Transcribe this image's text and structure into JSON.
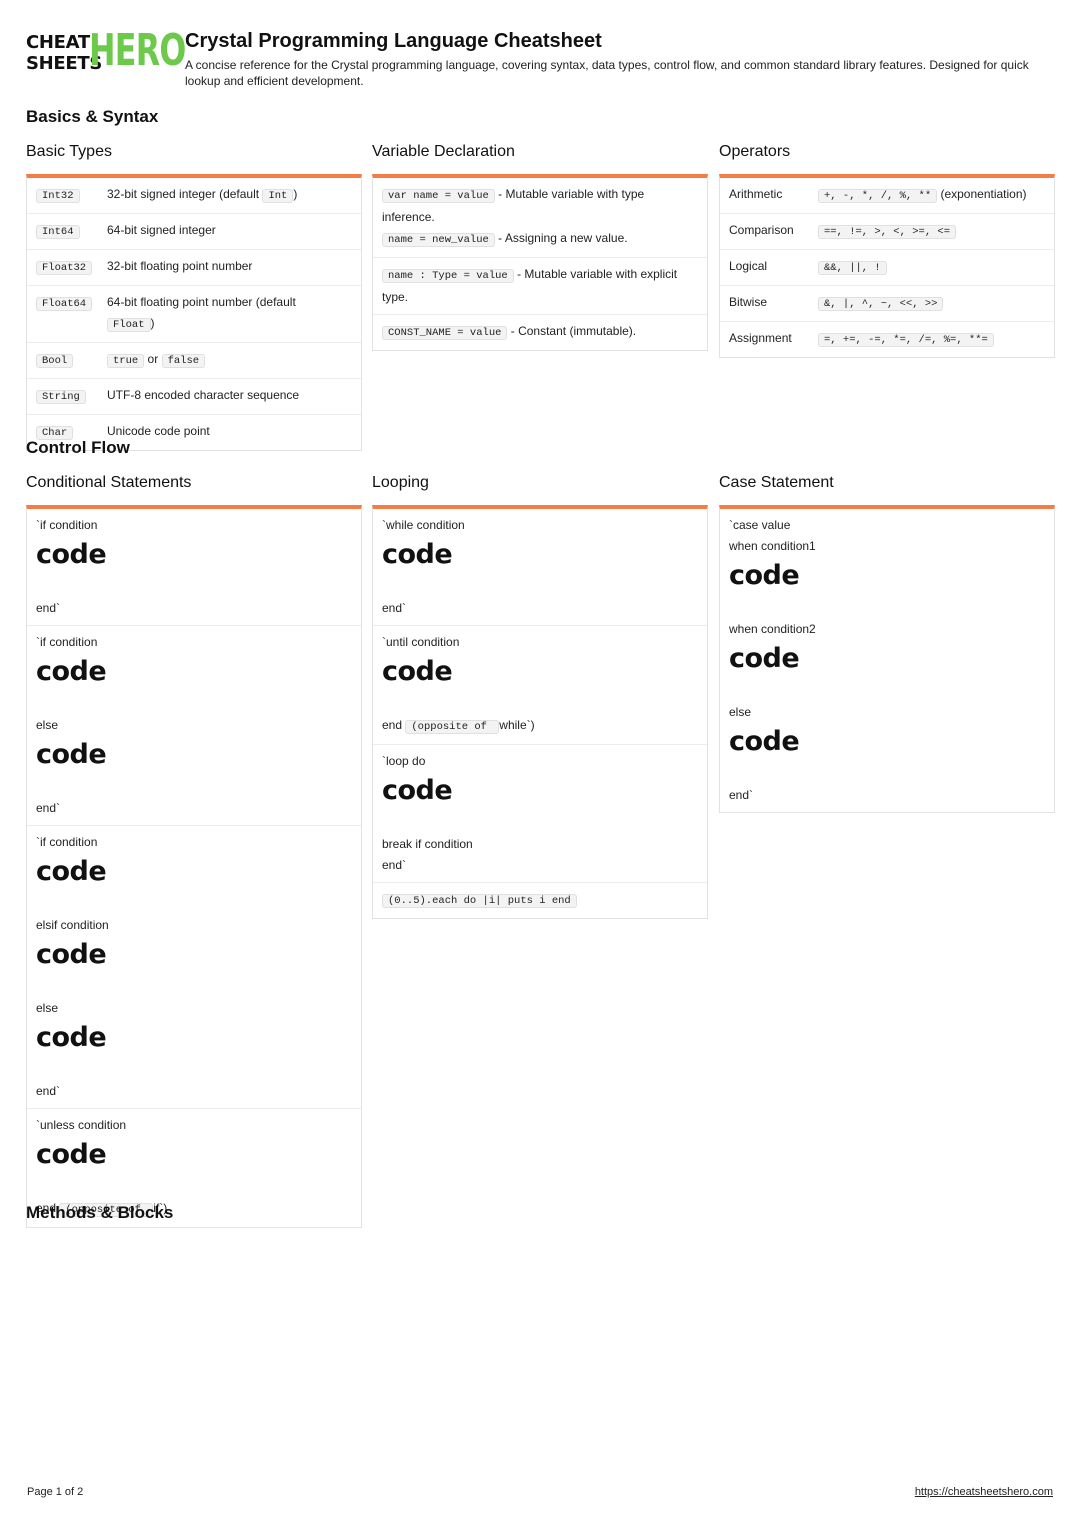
{
  "logo": {
    "line1": "CHEAT",
    "line2": "SHEETS",
    "hero": "HERO"
  },
  "header": {
    "title": "Crystal Programming Language Cheatsheet",
    "subtitle": "A concise reference for the Crystal programming language, covering syntax, data types, control flow, and common standard library features. Designed for quick lookup and efficient development."
  },
  "sections": {
    "basics": "Basics & Syntax",
    "control": "Control Flow",
    "methods": "Methods & Blocks"
  },
  "basic_types": {
    "title": "Basic Types",
    "rows": [
      {
        "k": "Int32",
        "v": "32-bit signed integer (default ",
        "code": "Int",
        "after": ")"
      },
      {
        "k": "Int64",
        "v": "64-bit signed integer"
      },
      {
        "k": "Float32",
        "v": "32-bit floating point number"
      },
      {
        "k": "Float64",
        "v": "64-bit floating point number (default ",
        "code": "Float",
        "after": ")"
      },
      {
        "k": "Bool",
        "code1": "true",
        "mid": " or ",
        "code2": "false"
      },
      {
        "k": "String",
        "v": "UTF-8 encoded character sequence"
      },
      {
        "k": "Char",
        "v": "Unicode code point"
      }
    ]
  },
  "variables": {
    "title": "Variable Declaration",
    "rows": [
      {
        "code": "var name = value",
        "v": " - Mutable variable with type inference.",
        "code2": "name = new_value",
        "v2": " - Assigning a new value."
      },
      {
        "code": "name : Type = value",
        "v": " - Mutable variable with explicit type."
      },
      {
        "code": "CONST_NAME = value",
        "v": " - Constant (immutable)."
      }
    ]
  },
  "operators": {
    "title": "Operators",
    "rows": [
      {
        "k": "Arithmetic",
        "code": "+, -, *, /, %, **",
        "after": " (exponentiation)"
      },
      {
        "k": "Comparison",
        "code": "==, !=, >, <, >=, <="
      },
      {
        "k": "Logical",
        "code": "&&, ||, !"
      },
      {
        "k": "Bitwise",
        "code": "&, |, ^, ~, <<, >>"
      },
      {
        "k": "Assignment",
        "code": "=, +=, -=, *=, /=, %=, **="
      }
    ]
  },
  "conditionals": {
    "title": "Conditional Statements",
    "big": "code",
    "b1": {
      "l1": "`if condition",
      "end": "end`"
    },
    "b2": {
      "l1": "`if condition",
      "l2": "else",
      "end": "end`"
    },
    "b3": {
      "l1": "`if condition",
      "l2": "elsif condition",
      "l3": "else",
      "end": "end`"
    },
    "b4": {
      "l1": "`unless condition",
      "end": "end",
      "code": "(opposite of ",
      "after": "if`)"
    }
  },
  "looping": {
    "title": "Looping",
    "big": "code",
    "b1": {
      "l1": "`while condition",
      "end": "end`"
    },
    "b2": {
      "l1": "`until condition",
      "end": "end",
      "code": "(opposite of ",
      "after": "while`)"
    },
    "b3": {
      "l1": "`loop do",
      "l2": "break if condition",
      "end": "end`"
    },
    "b4": {
      "code": "(0..5).each do |i| puts i end"
    }
  },
  "case_stmt": {
    "title": "Case Statement",
    "big": "code",
    "l1": "`case value",
    "l2": "when condition1",
    "l3": "when condition2",
    "l4": "else",
    "end": "end`"
  },
  "footer": {
    "page": "Page 1 of 2",
    "url": "https://cheatsheetshero.com"
  }
}
